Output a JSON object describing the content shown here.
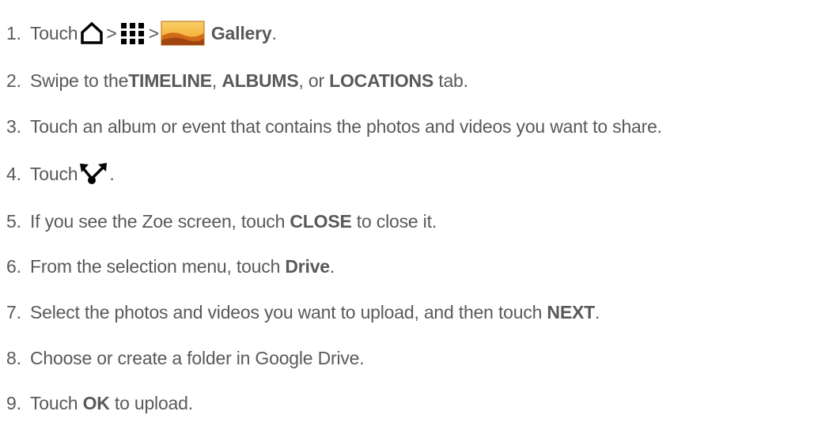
{
  "steps": [
    {
      "num": "1.",
      "parts": [
        "Touch",
        ">",
        ">",
        "Gallery",
        "."
      ]
    },
    {
      "num": "2.",
      "parts": [
        "Swipe to the ",
        "TIMELINE",
        ", ",
        "ALBUMS",
        ", or ",
        "LOCATIONS",
        " tab."
      ]
    },
    {
      "num": "3.",
      "parts": [
        "Touch an album or event that contains the photos and videos you want to share."
      ]
    },
    {
      "num": "4.",
      "parts": [
        "Touch",
        "."
      ]
    },
    {
      "num": "5.",
      "parts": [
        "If you see the Zoe screen, touch ",
        "CLOSE",
        " to close it."
      ]
    },
    {
      "num": "6.",
      "parts": [
        "From the selection menu, touch ",
        "Drive",
        "."
      ]
    },
    {
      "num": "7.",
      "parts": [
        "Select the photos and videos you want to upload, and then touch ",
        "NEXT",
        "."
      ]
    },
    {
      "num": "8.",
      "parts": [
        "Choose or create a folder in Google Drive."
      ]
    },
    {
      "num": "9.",
      "parts": [
        "Touch ",
        "OK",
        " to upload."
      ]
    }
  ],
  "icons": {
    "home": "home-icon",
    "apps": "apps-grid-icon",
    "gallery": "gallery-icon",
    "share": "share-icon"
  },
  "colors": {
    "text": "#595959",
    "icon": "#000000",
    "gallery_sky": "#f0a020",
    "gallery_hill": "#c05010"
  }
}
